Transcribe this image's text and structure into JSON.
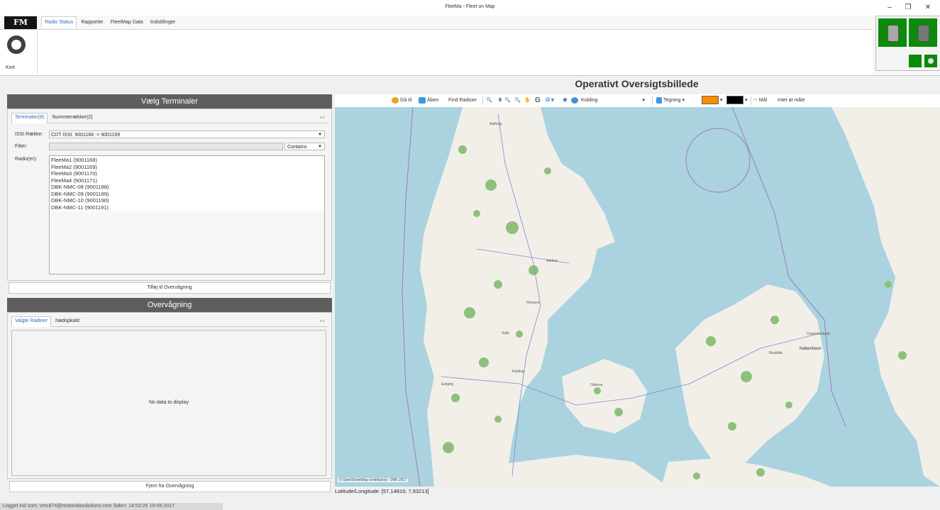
{
  "window": {
    "title": "FleeMa - Fleet on Map",
    "minimize": "–",
    "restore": "❐",
    "close": "✕"
  },
  "ribbon": {
    "logo": "FM",
    "tabs": [
      "Radio Status",
      "Rapporter",
      "FleetMap Data",
      "Indstillinger"
    ],
    "kort_label": "Kort"
  },
  "main_title": "Operativt Oversigtsbillede",
  "select_panel": {
    "header": "Vælg Terminaler",
    "tabs": [
      "Terminaler(8)",
      "Nummerrækker(2)"
    ],
    "scroll_arrows": "◂ ▸",
    "issi_label": "ISSI Række:",
    "issi_value": "CDT ISSI: 9001168 -> 9001199",
    "filter_label": "Filter:",
    "filter_mode": "Contains",
    "radios_label": "Radio(er):",
    "radios": [
      "FleeMa1 (9001168)",
      "FleeMa2 (9001169)",
      "FleeMa3 (9001170)",
      "FleeMa4 (9001171)",
      "DBK-NMC-08 (9001188)",
      "DBK-NMC-09 (9001189)",
      "DBK-NMC-10 (9001190)",
      "DBK-NMC-11 (9001191)"
    ],
    "add_button": "Tilføj til Overvågning"
  },
  "monitor_panel": {
    "header": "Overvågning",
    "tabs": [
      "Valgte Radioer",
      "Nødopkald"
    ],
    "scroll_arrows": "◂ ▸",
    "empty_text": "No data to display",
    "remove_button": "Fjern fra Overvågning"
  },
  "map_toolbar": {
    "goto": "Gå til",
    "open": "Åben",
    "find_radios": "Find Radioer",
    "zoom_level": "8",
    "location": "Kolding",
    "drawing": "Tegning",
    "measure": "Mål",
    "measure_status": "Intet at måle",
    "fill_color": "#ff8c00",
    "line_color": "#000000"
  },
  "map": {
    "places": [
      "Aalborg",
      "Aarhus",
      "Horsens",
      "Vejle",
      "Kolding",
      "Esbjerg",
      "Odense",
      "Roskilde",
      "København",
      "Charlottenlund"
    ],
    "attribution": "© OpenStreetMap contributors - DBK 2017",
    "water_color": "#aad3df",
    "land_color": "#f2efe9",
    "forest_color": "#8fc07a"
  },
  "coordinates": "Latitude/Longitude: [57,14816; 7,93213]",
  "status_bar": "Logget ind som: vmcd74@motorolasolutions.com Siden: 14:53:26 19-05-2017"
}
